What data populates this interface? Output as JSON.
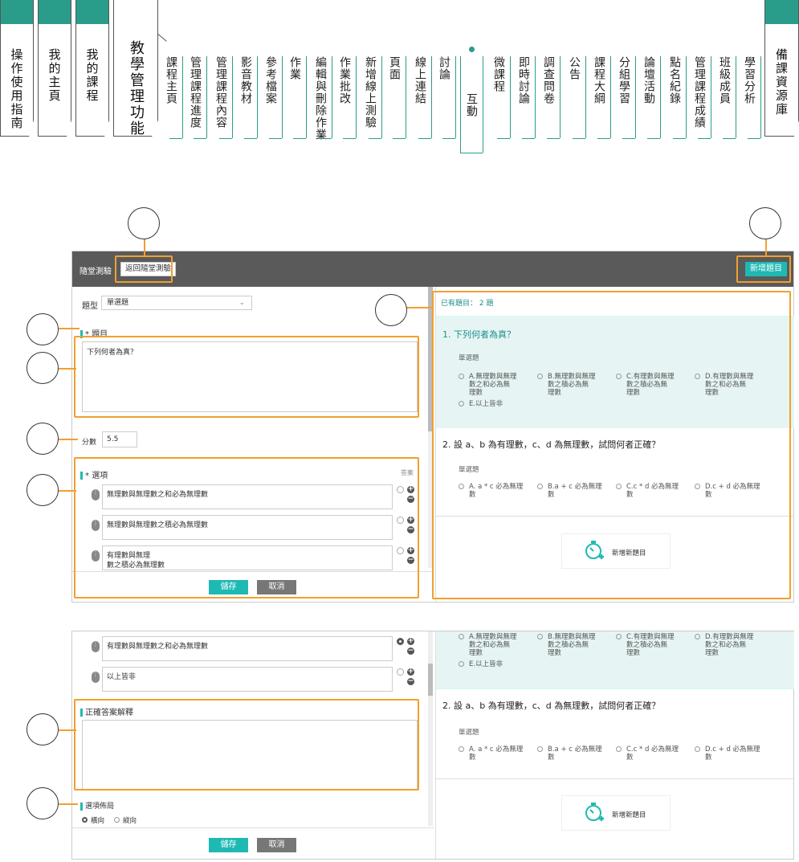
{
  "nav": {
    "left_tabs": [
      "操作使用指南",
      "我的主頁",
      "我的課程",
      "教學管理功能"
    ],
    "right_tab": "備課資源庫",
    "sub_items": [
      "課程主頁",
      "管理課程進度",
      "管理課程內容",
      "影音教材",
      "參考檔案",
      "作業",
      "編輯與刪除作業",
      "作業批改",
      "新增線上測驗",
      "頁面",
      "線上連結",
      "討論",
      "互動",
      "微課程",
      "即時討論",
      "調查問卷",
      "公告",
      "課程大綱",
      "分組學習",
      "論壇活動",
      "點名紀錄",
      "管理課程成績",
      "班級成員",
      "學習分析"
    ],
    "active_item": "互動"
  },
  "editor": {
    "header_title": "隨堂測驗",
    "back_button": "返回隨堂測驗",
    "add_button": "新增題目",
    "type_label": "題型",
    "type_value": "單選題",
    "question_label": "題目",
    "question_text": "下列何者為真？",
    "score_label": "分數",
    "score_value": "5.5",
    "options_label": "選項",
    "answer_label": "答案",
    "options_top": [
      "無理數與無理數之和必為無理數",
      "無理數與無理數之積必為無理數",
      "有理數與無理\n數之積必為無理數"
    ],
    "options_bottom": [
      "有理數與無理數之和必為無理數",
      "以上皆非"
    ],
    "explain_label": "正確答案解釋",
    "layout_label": "選項佈局",
    "layout_horizontal": "橫向",
    "layout_vertical": "縱向",
    "save": "儲存",
    "cancel": "取消",
    "required_mark": "*"
  },
  "preview": {
    "count_text": "已有題目： 2 題",
    "q1": {
      "title": "1.  下列何者為真？",
      "type": "單選題",
      "options": [
        "A.無理數與無理\n數之和必為無\n理數",
        "B.無理數與無理\n數之積必為無\n理數",
        "C.有理數與無理\n數之積必為無\n理數",
        "D.有理數與無理\n數之和必為無\n理數",
        "E.以上皆非"
      ]
    },
    "q2": {
      "title": "2.  設 a、b 為有理數，c、d 為無理數，試問何者正確？",
      "type": "單選題",
      "options": [
        "A. a * c 必為無理\n數",
        "B.a + c 必為無理\n數",
        "C.c * d 必為無理\n數",
        "D.c + d 必為無理\n數"
      ]
    },
    "add_new": "新增新題目"
  },
  "colors": {
    "accent": "#1fb9b3",
    "header": "#5a5a5a",
    "callout": "#f0a030",
    "nav": "#2a9d8a"
  }
}
